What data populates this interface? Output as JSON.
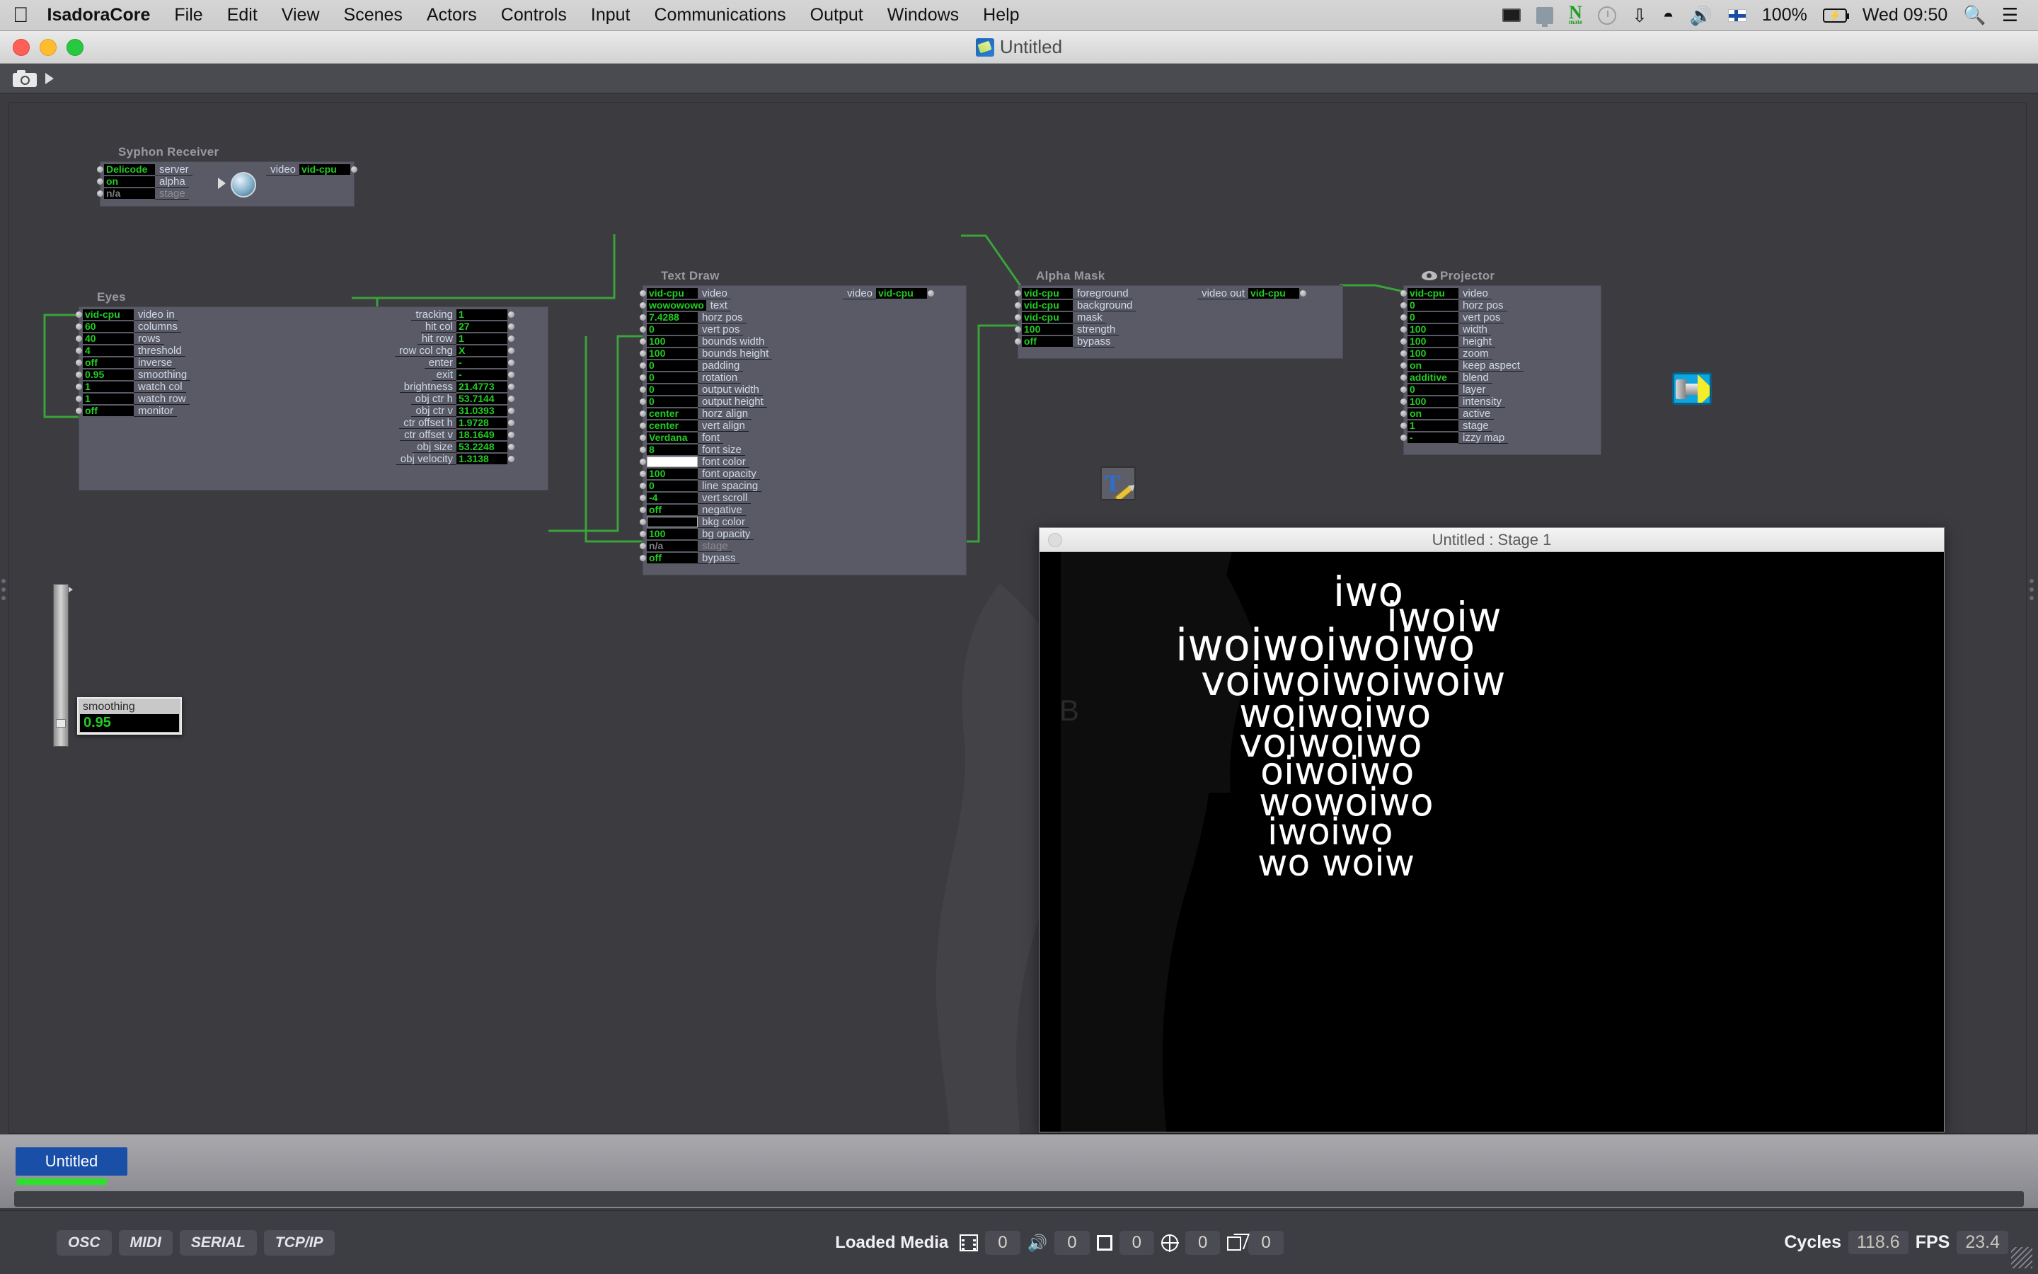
{
  "menubar": {
    "apple_icon": "apple-icon",
    "items": [
      "IsadoraCore",
      "File",
      "Edit",
      "View",
      "Scenes",
      "Actors",
      "Controls",
      "Input",
      "Communications",
      "Output",
      "Windows",
      "Help"
    ],
    "status": {
      "battery_percent": "100%",
      "clock": "Wed 09:50",
      "icons": [
        "screen-share-icon",
        "display-icon",
        "ni-mate-icon",
        "time-machine-icon",
        "bluetooth-icon",
        "wifi-icon",
        "volume-icon",
        "finnish-flag-icon",
        "battery-icon",
        "spotlight-search-icon",
        "notification-center-icon"
      ]
    }
  },
  "window": {
    "title": "Untitled",
    "doc_icon": "isadora-document-icon",
    "traffic_lights": [
      "close-button",
      "minimize-button",
      "zoom-button"
    ]
  },
  "toolbar": {
    "snapshot_icon": "camera-icon",
    "play_icon": "play-triangle-icon"
  },
  "actors": [
    {
      "id": "syphon-receiver",
      "title": "Syphon Receiver",
      "inputs": [
        {
          "value": "Delicode",
          "label": "server"
        },
        {
          "value": "on",
          "label": "alpha"
        },
        {
          "value": "n/a",
          "label": "stage",
          "dim": true
        }
      ],
      "outputs": [
        {
          "label": "video",
          "value": "vid-cpu"
        }
      ],
      "icon": "syphon-orb-icon"
    },
    {
      "id": "eyes",
      "title": "Eyes",
      "inputs": [
        {
          "value": "vid-cpu",
          "label": "video in"
        },
        {
          "value": "60",
          "label": "columns"
        },
        {
          "value": "40",
          "label": "rows"
        },
        {
          "value": "4",
          "label": "threshold"
        },
        {
          "value": "off",
          "label": "inverse"
        },
        {
          "value": "0.95",
          "label": "smoothing"
        },
        {
          "value": "1",
          "label": "watch col"
        },
        {
          "value": "1",
          "label": "watch row"
        },
        {
          "value": "off",
          "label": "monitor"
        }
      ],
      "outputs": [
        {
          "label": "tracking",
          "value": "1"
        },
        {
          "label": "hit col",
          "value": "27"
        },
        {
          "label": "hit row",
          "value": "1"
        },
        {
          "label": "row col chg",
          "value": "X"
        },
        {
          "label": "enter",
          "value": "-"
        },
        {
          "label": "exit",
          "value": "-"
        },
        {
          "label": "brightness",
          "value": "21.4773"
        },
        {
          "label": "obj ctr h",
          "value": "53.7144"
        },
        {
          "label": "obj ctr v",
          "value": "31.0393"
        },
        {
          "label": "ctr offset h",
          "value": "1.9728"
        },
        {
          "label": "ctr offset v",
          "value": "18.1649"
        },
        {
          "label": "obj size",
          "value": "53.2248"
        },
        {
          "label": "obj velocity",
          "value": "1.3138"
        }
      ],
      "icon": "eyes-grid-icon"
    },
    {
      "id": "text-draw",
      "title": "Text Draw",
      "inputs": [
        {
          "value": "vid-cpu",
          "label": "video"
        },
        {
          "value": "wowowowo",
          "label": "text"
        },
        {
          "value": "7.4288",
          "label": "horz pos"
        },
        {
          "value": "0",
          "label": "vert pos"
        },
        {
          "value": "100",
          "label": "bounds width"
        },
        {
          "value": "100",
          "label": "bounds height"
        },
        {
          "value": "0",
          "label": "padding"
        },
        {
          "value": "0",
          "label": "rotation"
        },
        {
          "value": "0",
          "label": "output width"
        },
        {
          "value": "0",
          "label": "output height"
        },
        {
          "value": "center",
          "label": "horz align"
        },
        {
          "value": "center",
          "label": "vert align"
        },
        {
          "value": "Verdana",
          "label": "font"
        },
        {
          "value": "8",
          "label": "font size"
        },
        {
          "value": "",
          "label": "font color",
          "swatch": "#ffffff"
        },
        {
          "value": "100",
          "label": "font opacity"
        },
        {
          "value": "0",
          "label": "line spacing"
        },
        {
          "value": "-4",
          "label": "vert scroll"
        },
        {
          "value": "off",
          "label": "negative"
        },
        {
          "value": "",
          "label": "bkg color",
          "swatch": "#000000"
        },
        {
          "value": "100",
          "label": "bg opacity"
        },
        {
          "value": "n/a",
          "label": "stage",
          "dim": true
        },
        {
          "value": "off",
          "label": "bypass"
        }
      ],
      "outputs": [
        {
          "label": "video",
          "value": "vid-cpu"
        }
      ],
      "icon": "text-draw-icon"
    },
    {
      "id": "alpha-mask",
      "title": "Alpha Mask",
      "inputs": [
        {
          "value": "vid-cpu",
          "label": "foreground"
        },
        {
          "value": "vid-cpu",
          "label": "background"
        },
        {
          "value": "vid-cpu",
          "label": "mask"
        },
        {
          "value": "100",
          "label": "strength"
        },
        {
          "value": "off",
          "label": "bypass"
        }
      ],
      "outputs": [
        {
          "label": "video out",
          "value": "vid-cpu"
        }
      ],
      "icon": "alpha-mask-icon"
    },
    {
      "id": "projector",
      "title": "Projector",
      "title_icon": "eye-icon",
      "inputs": [
        {
          "value": "vid-cpu",
          "label": "video"
        },
        {
          "value": "0",
          "label": "horz pos"
        },
        {
          "value": "0",
          "label": "vert pos"
        },
        {
          "value": "100",
          "label": "width"
        },
        {
          "value": "100",
          "label": "height"
        },
        {
          "value": "100",
          "label": "zoom"
        },
        {
          "value": "on",
          "label": "keep aspect"
        },
        {
          "value": "additive",
          "label": "blend"
        },
        {
          "value": "0",
          "label": "layer"
        },
        {
          "value": "100",
          "label": "intensity"
        },
        {
          "value": "on",
          "label": "active"
        },
        {
          "value": "1",
          "label": "stage"
        },
        {
          "value": "-",
          "label": "izzy map"
        }
      ],
      "outputs": [],
      "icon": "projector-icon"
    }
  ],
  "popup": {
    "label": "smoothing",
    "value": "0.95"
  },
  "stage": {
    "title": "Untitled : Stage 1",
    "corner_letter": "B",
    "lines": [
      "iwo",
      "iwoiw",
      "iwoiwoiwoiwo",
      "voiwoiwoiwoiw",
      "woiwoiwo",
      "voiwoiwo",
      "oiwoiwo",
      "wowoiwo",
      "iwoiwo",
      "wo woiw"
    ]
  },
  "scenes": {
    "tab_label": "Untitled"
  },
  "status": {
    "protocols": [
      "OSC",
      "MIDI",
      "SERIAL",
      "TCP/IP"
    ],
    "loaded_media_label": "Loaded Media",
    "media_counts": [
      {
        "icon": "film-icon",
        "value": "0"
      },
      {
        "icon": "audio-icon",
        "value": "0"
      },
      {
        "icon": "picture-icon",
        "value": "0"
      },
      {
        "icon": "globe-icon",
        "value": "0"
      },
      {
        "icon": "cube-icon",
        "value": "0"
      }
    ],
    "cycles_label": "Cycles",
    "cycles_value": "118.6",
    "fps_label": "FPS",
    "fps_value": "23.4"
  },
  "colors": {
    "accent_green": "#22cc22",
    "wire_green": "#3aa33a",
    "module_bg": "#5a5a66",
    "canvas_bg": "#3b3b40",
    "scene_tab_blue": "#1a4fa8"
  }
}
